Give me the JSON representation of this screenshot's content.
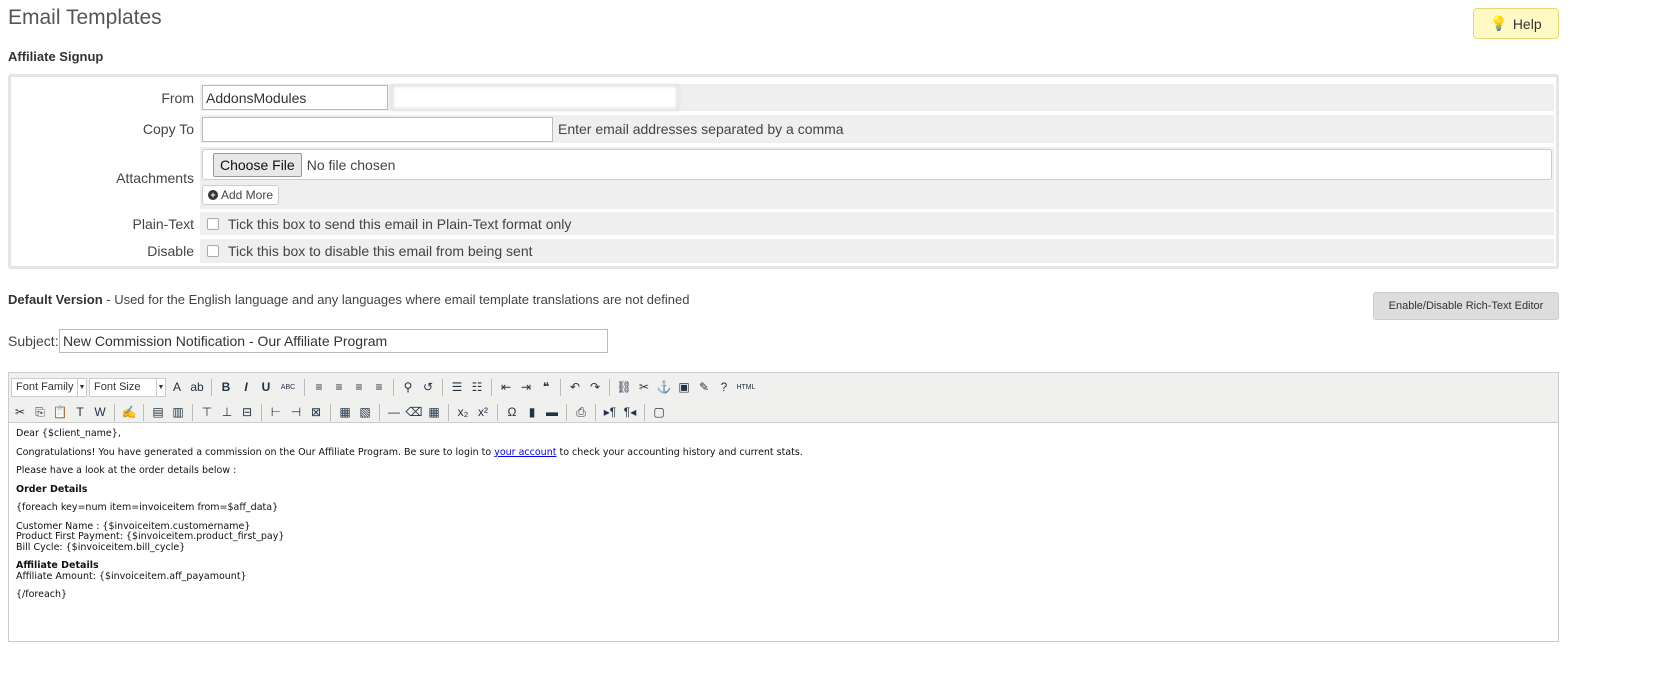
{
  "header": {
    "title": "Email Templates",
    "help_label": "Help",
    "section": "Affiliate Signup"
  },
  "form": {
    "from_label": "From",
    "from_name": "AddonsModules",
    "from_email": "",
    "copy_label": "Copy To",
    "copy_value": "",
    "copy_hint": "Enter email addresses separated by a comma",
    "attach_label": "Attachments",
    "choose_file": "Choose File",
    "no_file": "No file chosen",
    "add_more": "Add More",
    "plain_label": "Plain-Text",
    "plain_text": "Tick this box to send this email in Plain-Text format only",
    "disable_label": "Disable",
    "disable_text": "Tick this box to disable this email from being sent"
  },
  "version": {
    "title": "Default Version",
    "desc": " - Used for the English language and any languages where email template translations are not defined",
    "rte_button": "Enable/Disable Rich-Text Editor"
  },
  "subject": {
    "label": "Subject:",
    "value": "New Commission Notification - Our Affiliate Program"
  },
  "toolbar": {
    "font_family": "Font Family",
    "font_size": "Font Size",
    "row1": [
      [
        "font-color-icon",
        "A"
      ],
      [
        "highlight-icon",
        "ab"
      ],
      [
        "|"
      ],
      [
        "bold-icon",
        "B"
      ],
      [
        "italic-icon",
        "I"
      ],
      [
        "underline-icon",
        "U"
      ],
      [
        "strikethrough-icon",
        "ABC"
      ],
      [
        "|"
      ],
      [
        "align-left-icon",
        "≡"
      ],
      [
        "align-center-icon",
        "≡"
      ],
      [
        "align-right-icon",
        "≡"
      ],
      [
        "justify-icon",
        "≡"
      ],
      [
        "|"
      ],
      [
        "find-icon",
        "⚲"
      ],
      [
        "replace-icon",
        "↺"
      ],
      [
        "|"
      ],
      [
        "bullet-list-icon",
        "☰"
      ],
      [
        "numbered-list-icon",
        "☷"
      ],
      [
        "|"
      ],
      [
        "outdent-icon",
        "⇤"
      ],
      [
        "indent-icon",
        "⇥"
      ],
      [
        "blockquote-icon",
        "❝"
      ],
      [
        "|"
      ],
      [
        "undo-icon",
        "↶"
      ],
      [
        "redo-icon",
        "↷"
      ],
      [
        "|"
      ],
      [
        "link-icon",
        "⛓"
      ],
      [
        "unlink-icon",
        "✂"
      ],
      [
        "anchor-icon",
        "⚓"
      ],
      [
        "image-icon",
        "▣"
      ],
      [
        "cleanup-icon",
        "✎"
      ],
      [
        "help-icon",
        "?"
      ],
      [
        "html-icon",
        "HTML"
      ]
    ],
    "row2": [
      [
        "cut-icon",
        "✂"
      ],
      [
        "copy-icon",
        "⎘"
      ],
      [
        "paste-icon",
        "📋"
      ],
      [
        "paste-text-icon",
        "T"
      ],
      [
        "paste-word-icon",
        "W"
      ],
      [
        "|"
      ],
      [
        "edit-icon",
        "✍"
      ],
      [
        "|"
      ],
      [
        "table-row-icon",
        "▤"
      ],
      [
        "table-col-icon",
        "▥"
      ],
      [
        "|"
      ],
      [
        "row-before-icon",
        "⊤"
      ],
      [
        "row-after-icon",
        "⊥"
      ],
      [
        "delete-row-icon",
        "⊟"
      ],
      [
        "|"
      ],
      [
        "col-before-icon",
        "⊢"
      ],
      [
        "col-after-icon",
        "⊣"
      ],
      [
        "delete-col-icon",
        "⊠"
      ],
      [
        "|"
      ],
      [
        "split-cell-icon",
        "▦"
      ],
      [
        "merge-cell-icon",
        "▧"
      ],
      [
        "|"
      ],
      [
        "hr-icon",
        "—"
      ],
      [
        "eraser-icon",
        "⌫"
      ],
      [
        "table-icon",
        "▦"
      ],
      [
        "|"
      ],
      [
        "subscript-icon",
        "x₂"
      ],
      [
        "superscript-icon",
        "x²"
      ],
      [
        "|"
      ],
      [
        "charmap-icon",
        "Ω"
      ],
      [
        "media-icon",
        "▮"
      ],
      [
        "hr2-icon",
        "▬"
      ],
      [
        "|"
      ],
      [
        "print-icon",
        "⎙"
      ],
      [
        "|"
      ],
      [
        "ltr-icon",
        "▸¶"
      ],
      [
        "rtl-icon",
        "¶◂"
      ],
      [
        "|"
      ],
      [
        "fullscreen-icon",
        "▢"
      ]
    ]
  },
  "content": {
    "greeting": "Dear {$client_name},",
    "congrats_a": "Congratulations! You have generated a commission on the Our Affiliate Program. Be sure to login to ",
    "link": "your account",
    "congrats_b": " to check your accounting history and current stats.",
    "look": "Please have a look at the order details below :",
    "order_heading": "Order Details",
    "foreach": "{foreach key=num item=invoiceitem from=$aff_data}",
    "line1": "Customer Name : {$invoiceitem.customername}",
    "line2": "Product First Payment: {$invoiceitem.product_first_pay}",
    "line3": "Bill Cycle: {$invoiceitem.bill_cycle}",
    "aff_heading": "Affiliate Details",
    "aff_line": "Affiliate Amount: {$invoiceitem.aff_payamount}",
    "endforeach": "{/foreach}"
  }
}
